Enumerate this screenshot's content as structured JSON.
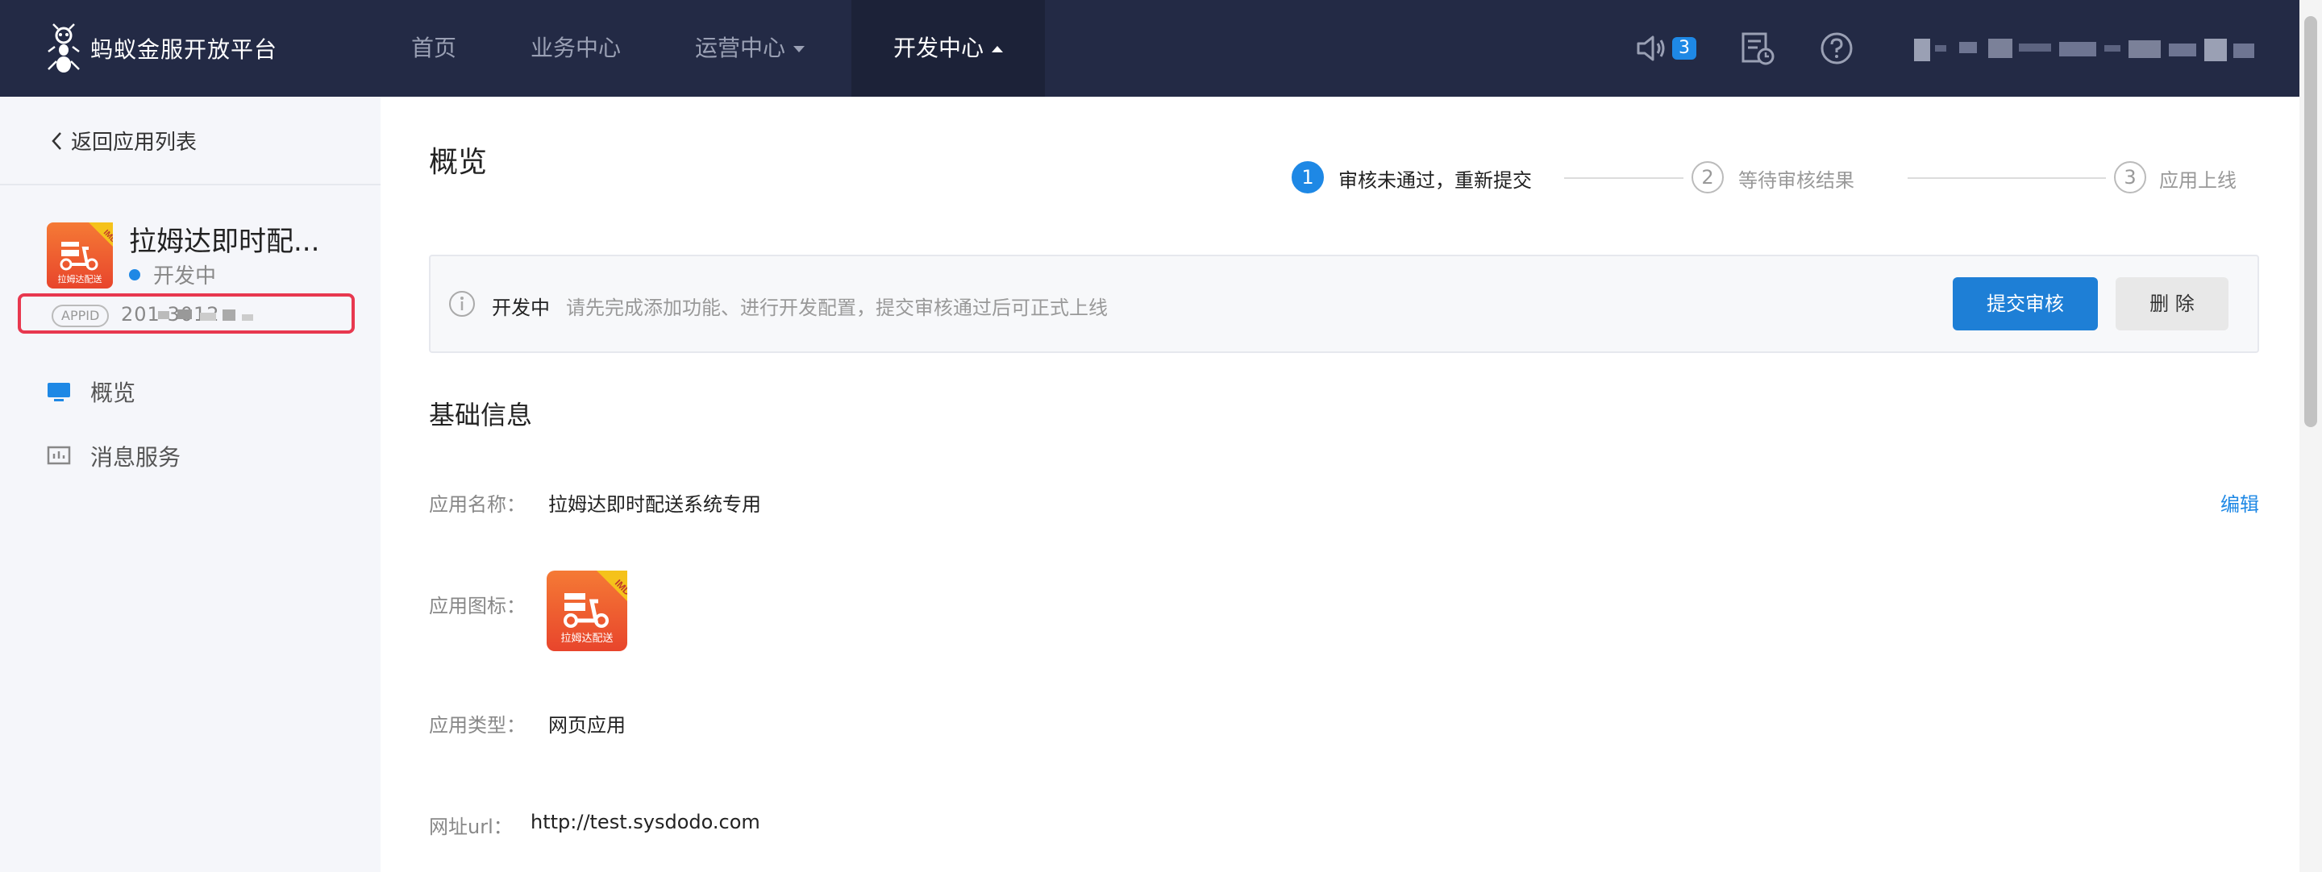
{
  "topbar": {
    "brand": "蚂蚁金服开放平台",
    "nav": [
      {
        "label": "首页"
      },
      {
        "label": "业务中心"
      },
      {
        "label": "运营中心"
      },
      {
        "label": "开发中心"
      }
    ],
    "notification_count": "3",
    "icons": [
      "speaker-icon",
      "document-clock-icon",
      "help-icon"
    ]
  },
  "sidebar": {
    "back_label": "返回应用列表",
    "app_name": "拉姆达即时配...",
    "app_status": "开发中",
    "appid_tag": "APPID",
    "appid_value": "201         3012",
    "menu": [
      {
        "label": "概览",
        "icon": "monitor-icon"
      },
      {
        "label": "消息服务",
        "icon": "chart-icon"
      }
    ]
  },
  "main": {
    "title": "概览",
    "steps": [
      {
        "num": "1",
        "label": "审核未通过，重新提交"
      },
      {
        "num": "2",
        "label": "等待审核结果"
      },
      {
        "num": "3",
        "label": "应用上线"
      }
    ],
    "notice": {
      "status": "开发中",
      "text": "请先完成添加功能、进行开发配置，提交审核通过后可正式上线",
      "submit_label": "提交审核",
      "delete_label": "删 除"
    },
    "section_title": "基础信息",
    "edit_label": "编辑",
    "fields": [
      {
        "label": "应用名称：",
        "value": "拉姆达即时配送系统专用"
      },
      {
        "label": "应用图标：",
        "value": ""
      },
      {
        "label": "应用类型：",
        "value": "网页应用"
      },
      {
        "label": "网址url：",
        "value": "http://test.sysdodo.com"
      }
    ],
    "app_icon_caption": "拉姆达配送",
    "app_icon_tag": "IMD"
  },
  "colors": {
    "topbar_bg": "#232a45",
    "accent": "#1e88e5",
    "highlight_border": "#e8384f",
    "sidebar_bg": "#f5f6fa"
  }
}
